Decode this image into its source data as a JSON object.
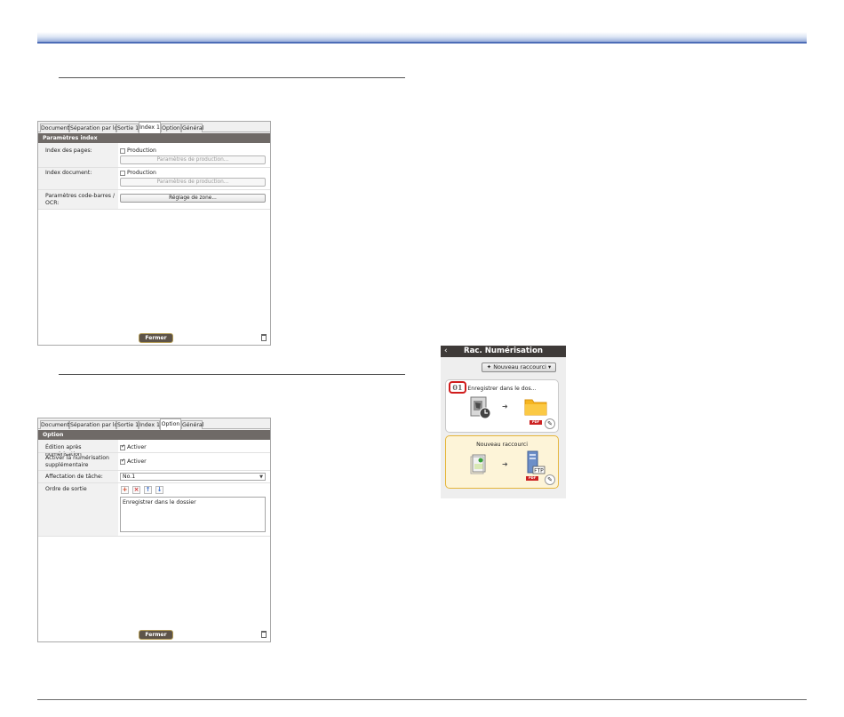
{
  "dialog_index": {
    "tabs": [
      "Document",
      "Séparation par lots",
      "Sortie 1",
      "Index 1",
      "Option",
      "Général"
    ],
    "active_tab": "Index 1",
    "section_title": "Paramètres index",
    "rows": {
      "page_index_label": "Index des pages:",
      "page_index_checkbox": "Production",
      "page_index_button": "Paramètres de production...",
      "doc_index_label": "Index document:",
      "doc_index_checkbox": "Production",
      "doc_index_button": "Paramètres de production...",
      "barcode_label": "Paramètres code-barres / OCR:",
      "barcode_button": "Réglage de zone..."
    },
    "close_label": "Fermer"
  },
  "dialog_option": {
    "tabs": [
      "Document",
      "Séparation par lots",
      "Sortie 1",
      "Index 1",
      "Option",
      "Général"
    ],
    "active_tab": "Option",
    "section_title": "Option",
    "rows": {
      "edit_label": "Édition après numérisation",
      "edit_checkbox": "Activer",
      "extra_scan_label": "Activer la numérisation supplémentaire",
      "extra_scan_checkbox": "Activer",
      "task_label": "Affectation de tâche:",
      "task_value": "No.1",
      "order_label": "Ordre de sortie",
      "order_items": [
        "Enregistrer dans le dossier"
      ]
    },
    "close_label": "Fermer"
  },
  "phone": {
    "title": "Rac. Numérisation",
    "new_shortcut": "Nouveau raccourci",
    "cards": [
      {
        "badge": "01",
        "name": "Enregistrer dans le dos...",
        "format": "PDF"
      },
      {
        "name": "Nouveau raccourci",
        "format": "PDF",
        "dest": "FTP"
      }
    ]
  },
  "colors": {
    "header_blue": "#4d6db7",
    "section_bar": "#6f6a67",
    "badge_red": "#d01c1c",
    "selected_card": "#fdf4d8"
  }
}
